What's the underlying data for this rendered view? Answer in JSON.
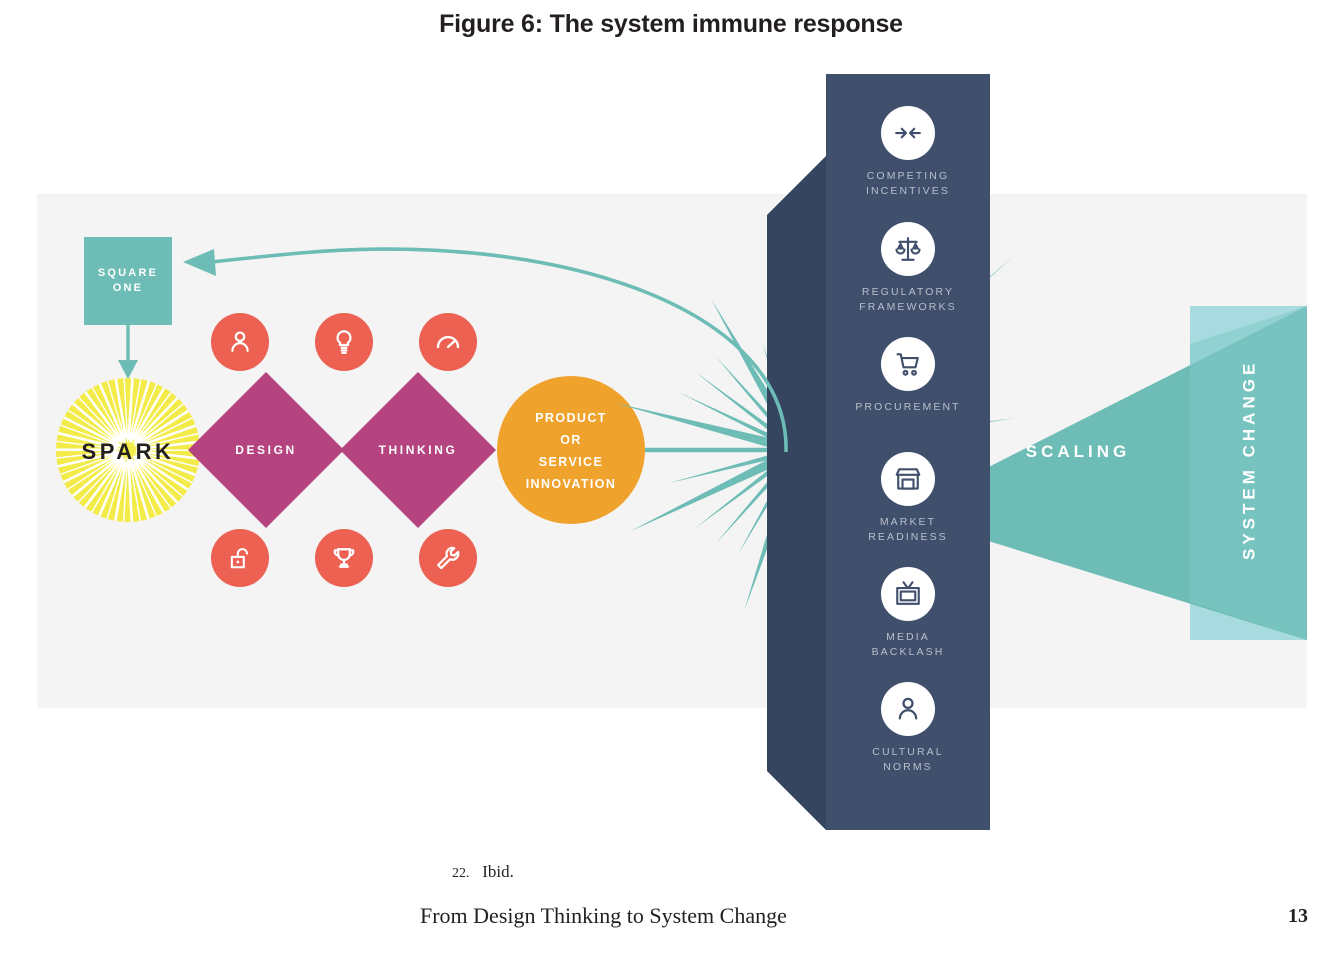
{
  "figure": {
    "title": "Figure 6: The system immune response"
  },
  "diagram": {
    "square_one": {
      "label": "SQUARE\nONE"
    },
    "spark": {
      "label": "SPARK"
    },
    "design": {
      "label": "DESIGN"
    },
    "thinking": {
      "label": "THINKING"
    },
    "innovation": {
      "label": "PRODUCT\nOR\nSERVICE\nINNOVATION"
    },
    "scaling": {
      "label": "SCALING"
    },
    "system_change": {
      "label": "SYSTEM CHANGE"
    },
    "enabler_icons_top": [
      {
        "name": "person-icon"
      },
      {
        "name": "lightbulb-icon"
      },
      {
        "name": "speedometer-icon"
      }
    ],
    "enabler_icons_bottom": [
      {
        "name": "unlocked-padlock-icon"
      },
      {
        "name": "trophy-icon"
      },
      {
        "name": "wrench-icon"
      }
    ],
    "barriers": [
      {
        "label": "COMPETING\nINCENTIVES",
        "icon": "arrows-colliding-icon"
      },
      {
        "label": "REGULATORY\nFRAMEWORKS",
        "icon": "scales-of-justice-icon"
      },
      {
        "label": "PROCUREMENT",
        "icon": "shopping-cart-icon"
      },
      {
        "label": "MARKET\nREADINESS",
        "icon": "storefront-icon"
      },
      {
        "label": "MEDIA\nBACKLASH",
        "icon": "television-icon"
      },
      {
        "label": "CULTURAL\nNORMS",
        "icon": "person-icon"
      }
    ]
  },
  "footnote": {
    "number": "22.",
    "text": "Ibid."
  },
  "footer": {
    "title": "From Design Thinking to System Change",
    "page": "13"
  },
  "colors": {
    "teal": "#6dbcb5",
    "teal_dark": "#5fb3ad",
    "teal_light": "#a8dbdf",
    "yellow": "#f2eb49",
    "magenta": "#b4437f",
    "coral": "#ec6152",
    "orange": "#efa22c",
    "navy_front": "#404f6b",
    "navy_side": "#36455f",
    "panel_gray": "#f4f4f4"
  }
}
